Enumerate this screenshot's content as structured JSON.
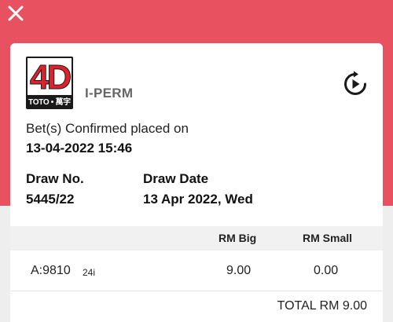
{
  "colors": {
    "accent": "#e8515f",
    "logo_red": "#e0202a"
  },
  "header": {
    "close_icon": "close-icon"
  },
  "ticket": {
    "logo": {
      "main": "4D",
      "sub": "TOTO • 萬字"
    },
    "product": "I-PERM",
    "replay_icon": "replay-icon",
    "confirm_label": "Bet(s) Confirmed placed on",
    "confirm_datetime": "13-04-2022 15:46",
    "draw_no_label": "Draw No.",
    "draw_no": "5445/22",
    "draw_date_label": "Draw Date",
    "draw_date": "13 Apr 2022, Wed"
  },
  "table": {
    "columns": [
      "RM Big",
      "RM Small"
    ],
    "rows": [
      {
        "number": "A:9810",
        "type": "24i",
        "big": "9.00",
        "small": "0.00"
      }
    ],
    "total": "TOTAL RM 9.00"
  }
}
